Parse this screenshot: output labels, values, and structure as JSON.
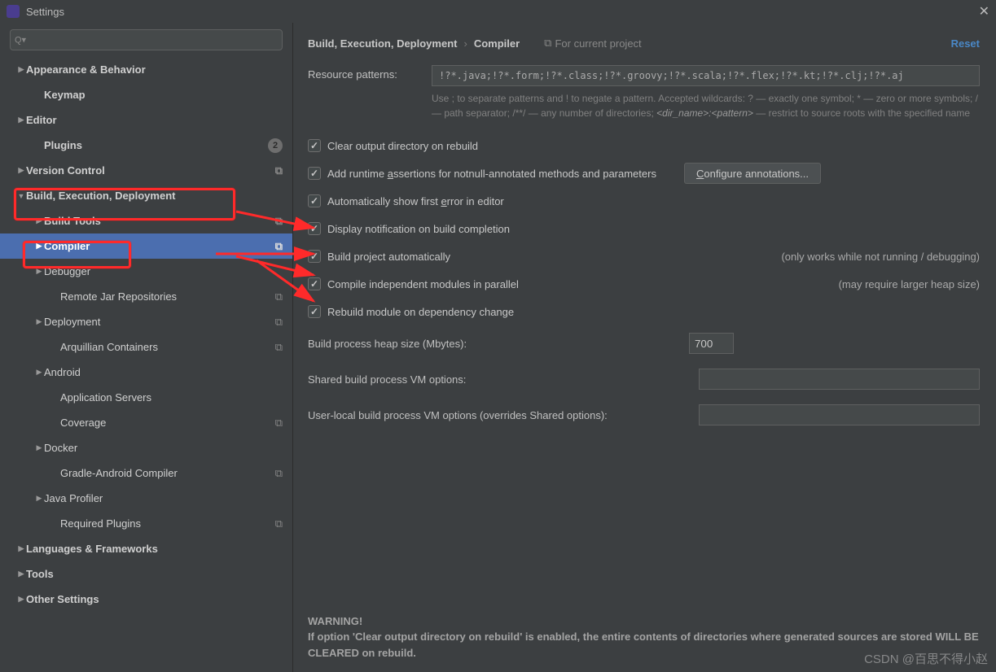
{
  "window": {
    "title": "Settings"
  },
  "search": {
    "placeholder": ""
  },
  "sidebar": {
    "items": [
      {
        "label": "Appearance & Behavior"
      },
      {
        "label": "Keymap"
      },
      {
        "label": "Editor"
      },
      {
        "label": "Plugins",
        "badge": "2"
      },
      {
        "label": "Version Control"
      },
      {
        "label": "Build, Execution, Deployment"
      },
      {
        "label": "Build Tools"
      },
      {
        "label": "Compiler"
      },
      {
        "label": "Debugger"
      },
      {
        "label": "Remote Jar Repositories"
      },
      {
        "label": "Deployment"
      },
      {
        "label": "Arquillian Containers"
      },
      {
        "label": "Android"
      },
      {
        "label": "Application Servers"
      },
      {
        "label": "Coverage"
      },
      {
        "label": "Docker"
      },
      {
        "label": "Gradle-Android Compiler"
      },
      {
        "label": "Java Profiler"
      },
      {
        "label": "Required Plugins"
      },
      {
        "label": "Languages & Frameworks"
      },
      {
        "label": "Tools"
      },
      {
        "label": "Other Settings"
      }
    ]
  },
  "breadcrumb": {
    "parent": "Build, Execution, Deployment",
    "current": "Compiler"
  },
  "forProject": "For current project",
  "reset": "Reset",
  "resource": {
    "label": "Resource patterns:",
    "value": "!?*.java;!?*.form;!?*.class;!?*.groovy;!?*.scala;!?*.flex;!?*.kt;!?*.clj;!?*.aj",
    "help1": "Use ; to separate patterns and ! to negate a pattern. Accepted wildcards: ? — exactly one symbol; * — zero or more symbols; / — path separator; /**/ — any number of directories; ",
    "help2": "<dir_name>:<pattern>",
    "help3": " — restrict to source roots with the specified name"
  },
  "checks": {
    "clear": "Clear output directory on rebuild",
    "runtime": "Add runtime assertions for notnull-annotated methods and parameters",
    "autoErr": "Automatically show first error in editor",
    "notif": "Display notification on build completion",
    "buildAuto": "Build project automatically",
    "buildAutoNote": "(only works while not running / debugging)",
    "parallel": "Compile independent modules in parallel",
    "parallelNote": "(may require larger heap size)",
    "rebuildDep": "Rebuild module on dependency change"
  },
  "configureBtn": "Configure annotations...",
  "fields": {
    "heapLabel": "Build process heap size (Mbytes):",
    "heapValue": "700",
    "sharedLabel": "Shared build process VM options:",
    "sharedValue": "",
    "userLabel": "User-local build process VM options (overrides Shared options):",
    "userValue": ""
  },
  "warning": {
    "title": "WARNING!",
    "body": "If option 'Clear output directory on rebuild' is enabled, the entire contents of directories where generated sources are stored WILL BE CLEARED on rebuild."
  },
  "watermark": "CSDN @百思不得小赵"
}
